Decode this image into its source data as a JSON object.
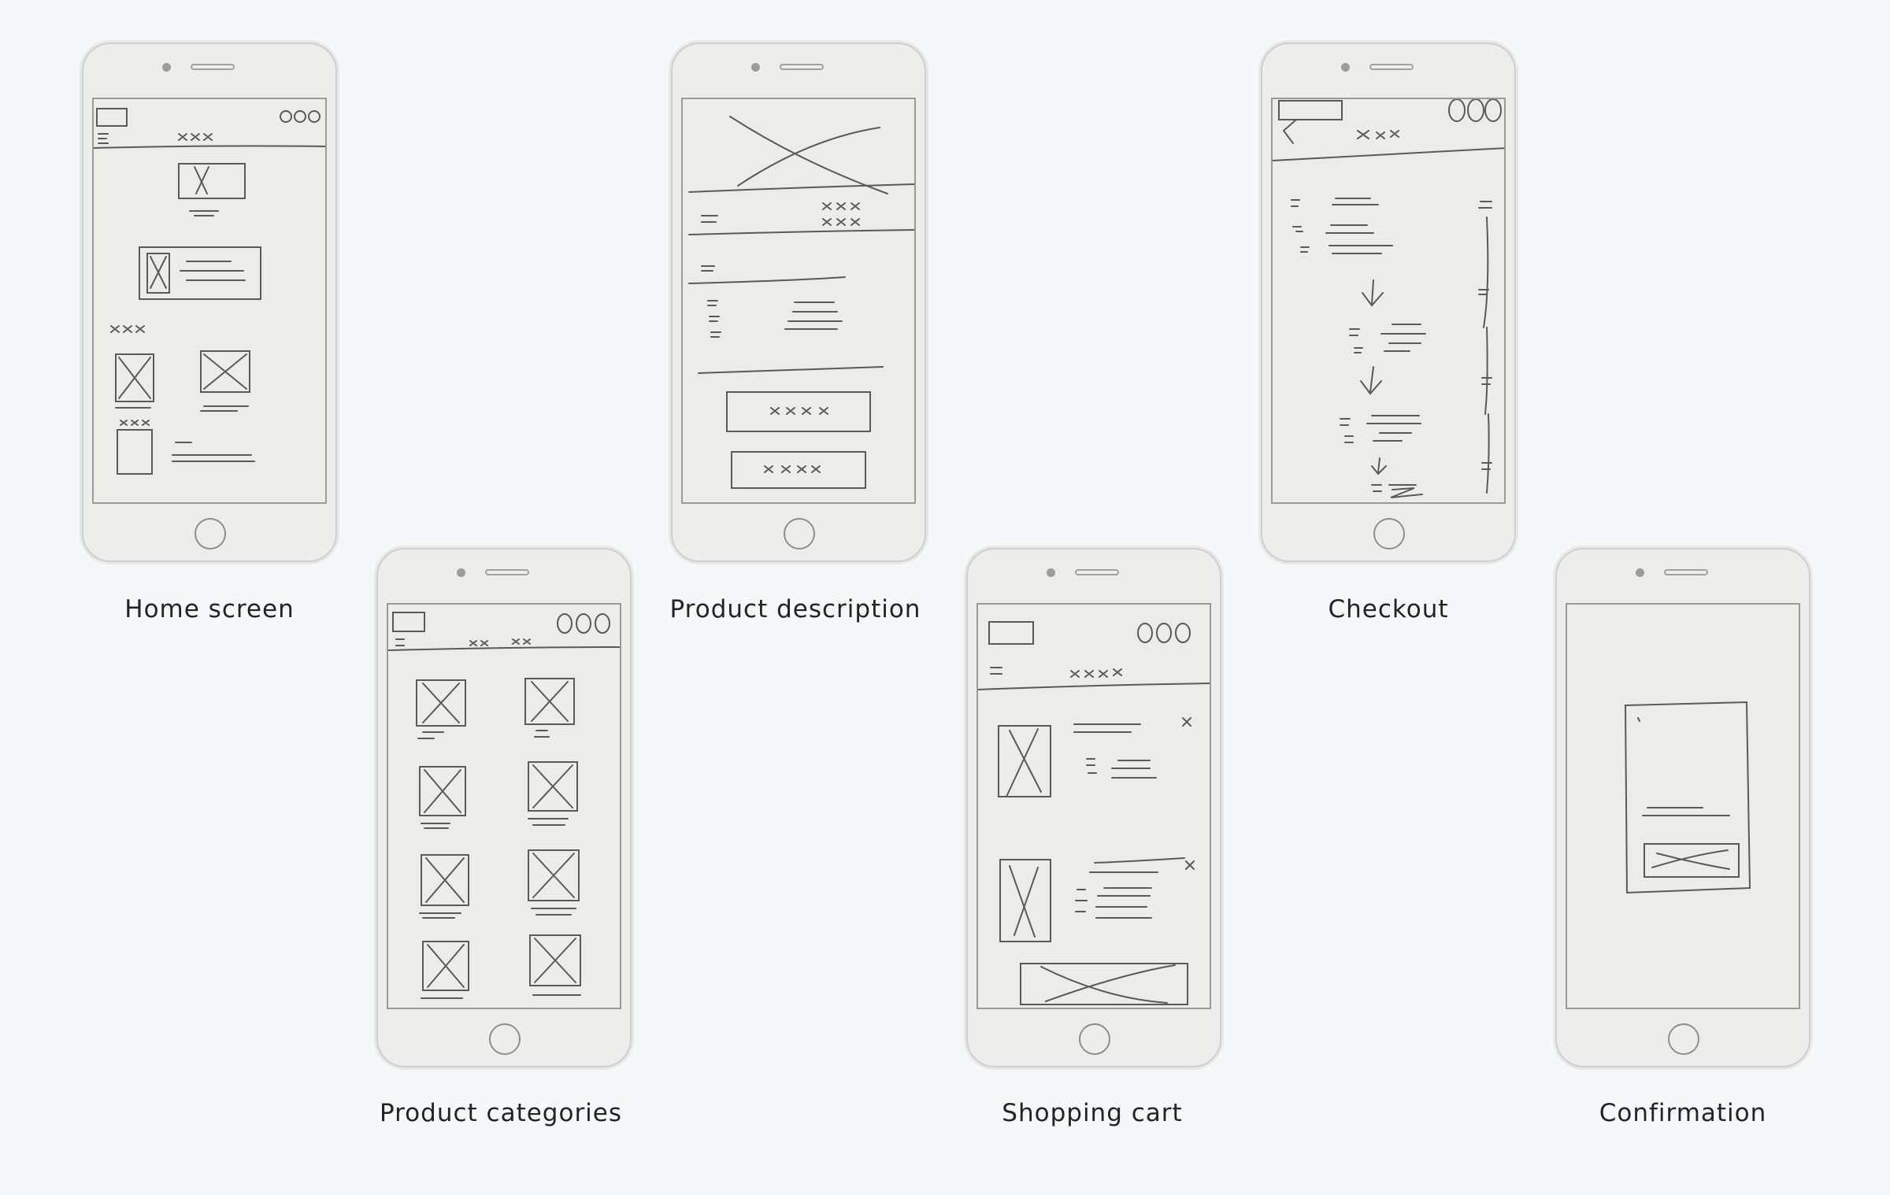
{
  "wireframes": [
    {
      "id": "home",
      "label": "Home screen"
    },
    {
      "id": "categories",
      "label": "Product categories"
    },
    {
      "id": "description",
      "label": "Product description"
    },
    {
      "id": "cart",
      "label": "Shopping cart"
    },
    {
      "id": "checkout",
      "label": "Checkout"
    },
    {
      "id": "confirmation",
      "label": "Confirmation"
    }
  ]
}
